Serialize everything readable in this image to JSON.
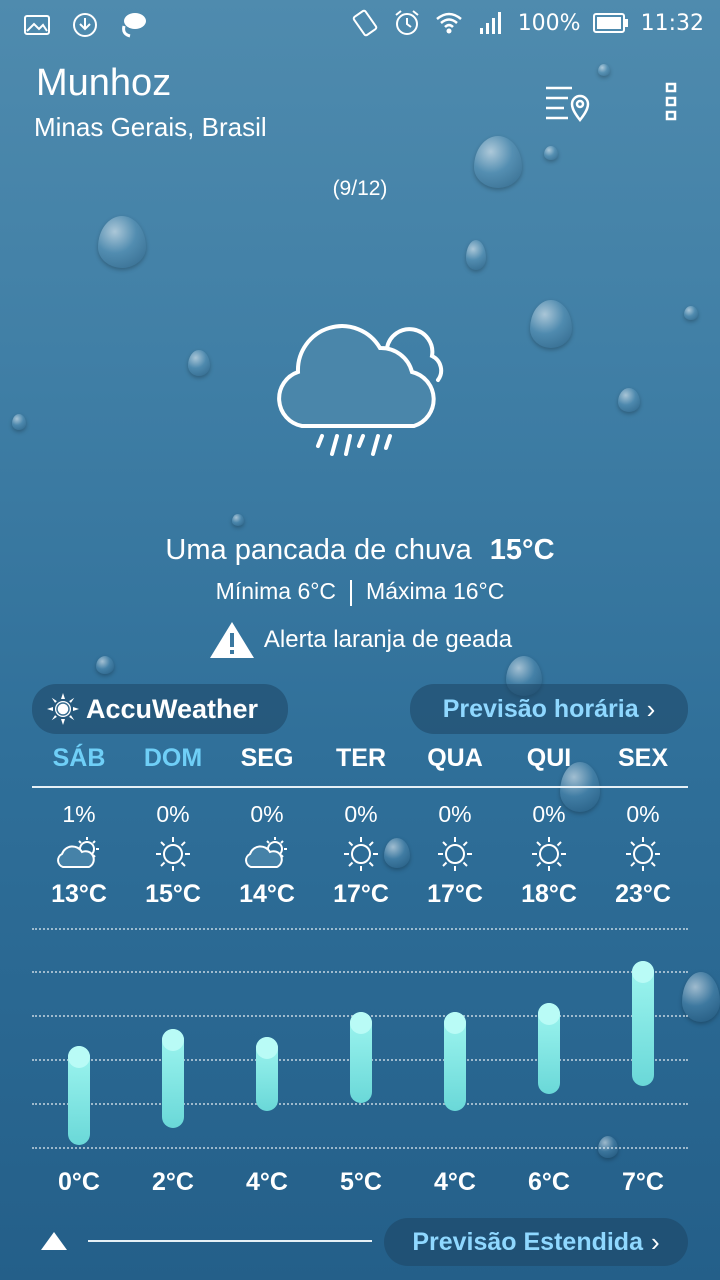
{
  "status_bar": {
    "battery": "100%",
    "time": "11:32",
    "icons": [
      "image-icon",
      "download-icon",
      "chat-icon",
      "rotate-icon",
      "alarm-icon",
      "wifi-icon",
      "signal-icon",
      "battery-icon"
    ]
  },
  "location": {
    "city": "Munhoz",
    "region": "Minas Gerais, Brasil",
    "page_indicator": "(9/12)"
  },
  "current": {
    "icon": "rain-cloud-icon",
    "condition": "Uma pancada de chuva",
    "temperature": "15°C",
    "min": "Mínima 6°C",
    "max": "Máxima 16°C",
    "alert": "Alerta laranja de geada"
  },
  "provider": {
    "name": "AccuWeather",
    "icon": "sun-logo-icon"
  },
  "buttons": {
    "hourly": "Previsão horária",
    "extended": "Previsão Estendida"
  },
  "forecast": [
    {
      "day": "SÁB",
      "highlight": true,
      "precip": "1%",
      "icon": "partly-cloudy-icon",
      "high": "13°C",
      "low": "0°C",
      "high_value": 13,
      "low_value": 0
    },
    {
      "day": "DOM",
      "highlight": true,
      "precip": "0%",
      "icon": "sunny-icon",
      "high": "15°C",
      "low": "2°C",
      "high_value": 15,
      "low_value": 2
    },
    {
      "day": "SEG",
      "highlight": false,
      "precip": "0%",
      "icon": "partly-cloudy-icon",
      "high": "14°C",
      "low": "4°C",
      "high_value": 14,
      "low_value": 4
    },
    {
      "day": "TER",
      "highlight": false,
      "precip": "0%",
      "icon": "sunny-icon",
      "high": "17°C",
      "low": "5°C",
      "high_value": 17,
      "low_value": 5
    },
    {
      "day": "QUA",
      "highlight": false,
      "precip": "0%",
      "icon": "sunny-icon",
      "high": "17°C",
      "low": "4°C",
      "high_value": 17,
      "low_value": 4
    },
    {
      "day": "QUI",
      "highlight": false,
      "precip": "0%",
      "icon": "sunny-icon",
      "high": "18°C",
      "low": "6°C",
      "high_value": 18,
      "low_value": 6
    },
    {
      "day": "SEX",
      "highlight": false,
      "precip": "0%",
      "icon": "sunny-icon",
      "high": "23°C",
      "low": "7°C",
      "high_value": 23,
      "low_value": 7
    }
  ],
  "colors": {
    "accent": "#8fd8ff",
    "day_highlight": "#6fcff7",
    "bar": "#8eeee8"
  }
}
